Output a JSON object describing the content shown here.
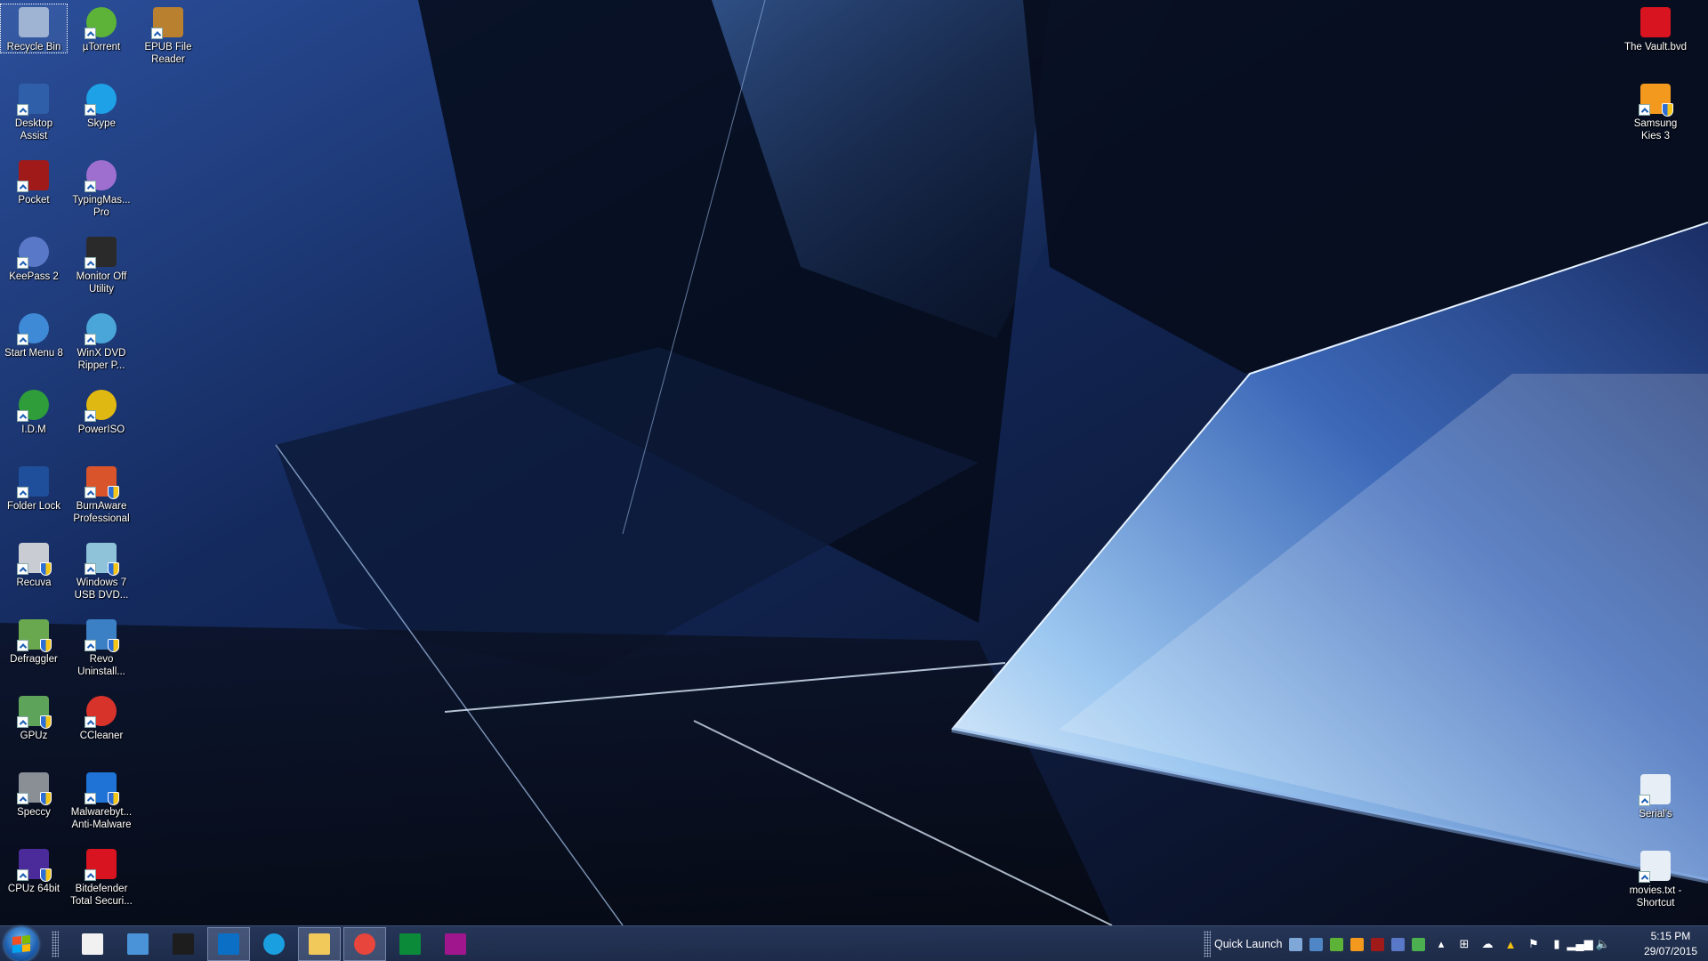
{
  "desktop": {
    "left_icons": [
      {
        "label": "Recycle Bin",
        "icon": "recycle-bin-icon",
        "col": 0,
        "row": 0,
        "selected": true,
        "shortcut": false,
        "shield": false,
        "color": "#9fb4d2"
      },
      {
        "label": "µTorrent",
        "icon": "utorrent-icon",
        "col": 1,
        "row": 0,
        "shortcut": true,
        "shield": false,
        "color": "#5cb338"
      },
      {
        "label": "EPUB File Reader",
        "icon": "epub-reader-icon",
        "col": 2,
        "row": 0,
        "shortcut": true,
        "shield": false,
        "color": "#b9802f"
      },
      {
        "label": "Desktop Assist",
        "icon": "desktop-assist-icon",
        "col": 0,
        "row": 1,
        "shortcut": true,
        "shield": false,
        "color": "#2f5fa8"
      },
      {
        "label": "Skype",
        "icon": "skype-icon",
        "col": 1,
        "row": 1,
        "shortcut": true,
        "shield": false,
        "color": "#1ea1e6"
      },
      {
        "label": "Pocket",
        "icon": "pocket-icon",
        "col": 0,
        "row": 2,
        "shortcut": true,
        "shield": false,
        "color": "#a11a1a"
      },
      {
        "label": "TypingMas... Pro",
        "icon": "typingmaster-icon",
        "col": 1,
        "row": 2,
        "shortcut": true,
        "shield": false,
        "color": "#9f6fd0"
      },
      {
        "label": "KeePass 2",
        "icon": "keepass-icon",
        "col": 0,
        "row": 3,
        "shortcut": true,
        "shield": false,
        "color": "#5a78c8"
      },
      {
        "label": "Monitor Off Utility",
        "icon": "monitor-off-icon",
        "col": 1,
        "row": 3,
        "shortcut": true,
        "shield": false,
        "color": "#2a2a2a"
      },
      {
        "label": "Start Menu 8",
        "icon": "start-menu-8-icon",
        "col": 0,
        "row": 4,
        "shortcut": true,
        "shield": false,
        "color": "#3f8ad6"
      },
      {
        "label": "WinX DVD Ripper P...",
        "icon": "winx-dvd-icon",
        "col": 1,
        "row": 4,
        "shortcut": true,
        "shield": false,
        "color": "#4aa6d8"
      },
      {
        "label": "I.D.M",
        "icon": "idm-icon",
        "col": 0,
        "row": 5,
        "shortcut": true,
        "shield": false,
        "color": "#2e9d3a"
      },
      {
        "label": "PowerISO",
        "icon": "poweriso-icon",
        "col": 1,
        "row": 5,
        "shortcut": true,
        "shield": false,
        "color": "#e0b812"
      },
      {
        "label": "Folder Lock",
        "icon": "folder-lock-icon",
        "col": 0,
        "row": 6,
        "shortcut": true,
        "shield": false,
        "color": "#1f4f9a"
      },
      {
        "label": "BurnAware Professional",
        "icon": "burnaware-icon",
        "col": 1,
        "row": 6,
        "shortcut": true,
        "shield": true,
        "color": "#d9542b"
      },
      {
        "label": "Recuva",
        "icon": "recuva-icon",
        "col": 0,
        "row": 7,
        "shortcut": true,
        "shield": true,
        "color": "#c9cdd3"
      },
      {
        "label": "Windows 7 USB DVD...",
        "icon": "win7-usb-dvd-icon",
        "col": 1,
        "row": 7,
        "shortcut": true,
        "shield": true,
        "color": "#8fc3d9"
      },
      {
        "label": "Defraggler",
        "icon": "defraggler-icon",
        "col": 0,
        "row": 8,
        "shortcut": true,
        "shield": true,
        "color": "#6aa84f"
      },
      {
        "label": "Revo Uninstall...",
        "icon": "revo-uninstaller-icon",
        "col": 1,
        "row": 8,
        "shortcut": true,
        "shield": true,
        "color": "#3b7fc4"
      },
      {
        "label": "GPUz",
        "icon": "gpuz-icon",
        "col": 0,
        "row": 9,
        "shortcut": true,
        "shield": true,
        "color": "#5ea35a"
      },
      {
        "label": "CCleaner",
        "icon": "ccleaner-icon",
        "col": 1,
        "row": 9,
        "shortcut": true,
        "shield": false,
        "color": "#d8332b"
      },
      {
        "label": "Speccy",
        "icon": "speccy-icon",
        "col": 0,
        "row": 10,
        "shortcut": true,
        "shield": true,
        "color": "#8a8f96"
      },
      {
        "label": "Malwarebyt... Anti-Malware",
        "icon": "malwarebytes-icon",
        "col": 1,
        "row": 10,
        "shortcut": true,
        "shield": true,
        "color": "#1f73d6"
      },
      {
        "label": "CPUz 64bit",
        "icon": "cpuz-icon",
        "col": 0,
        "row": 11,
        "shortcut": true,
        "shield": true,
        "color": "#4b2a9a"
      },
      {
        "label": "Bitdefender Total Securi...",
        "icon": "bitdefender-icon",
        "col": 1,
        "row": 11,
        "shortcut": true,
        "shield": false,
        "color": "#d7141f"
      }
    ],
    "right_icons": [
      {
        "label": "The Vault.bvd",
        "icon": "bitdefender-vault-icon",
        "slot": "top0",
        "shortcut": false,
        "shield": false,
        "color": "#d7141f"
      },
      {
        "label": "Samsung Kies 3",
        "icon": "samsung-kies-icon",
        "slot": "top1",
        "shortcut": true,
        "shield": true,
        "color": "#f39a1e"
      },
      {
        "label": "Serial's",
        "icon": "text-file-icon",
        "slot": "bottom1",
        "shortcut": true,
        "shield": false,
        "color": "#e8eef6"
      },
      {
        "label": "movies.txt - Shortcut",
        "icon": "text-file-icon",
        "slot": "bottom0",
        "shortcut": true,
        "shield": false,
        "color": "#e8eef6"
      }
    ]
  },
  "taskbar": {
    "start_button": "start-button",
    "pinned": [
      {
        "name": "apps-launcher",
        "icon": "apps-grid-icon",
        "active": false
      },
      {
        "name": "control-panel",
        "icon": "control-panel-icon",
        "active": false
      },
      {
        "name": "plex-app",
        "icon": "plex-chevron-icon",
        "active": false
      },
      {
        "name": "mail",
        "icon": "mail-icon",
        "active": true
      },
      {
        "name": "internet-explorer",
        "icon": "internet-explorer-icon",
        "active": false
      },
      {
        "name": "file-explorer",
        "icon": "file-explorer-icon",
        "active": true
      },
      {
        "name": "chrome",
        "icon": "chrome-icon",
        "active": true
      },
      {
        "name": "windows-store",
        "icon": "store-icon",
        "active": false
      },
      {
        "name": "camera",
        "icon": "camera-icon",
        "active": false
      }
    ],
    "quick_launch": {
      "label": "Quick Launch",
      "items": [
        {
          "icon": "show-desktop-icon",
          "color": "#7fa8d8"
        },
        {
          "icon": "switch-windows-icon",
          "color": "#4f86c6"
        },
        {
          "icon": "utorrent-icon",
          "color": "#5cb338"
        },
        {
          "icon": "samsung-kies-icon",
          "color": "#f39a1e"
        },
        {
          "icon": "pocket-icon",
          "color": "#a11a1a"
        },
        {
          "icon": "keepass-icon",
          "color": "#5a78c8"
        },
        {
          "icon": "pushbullet-icon",
          "color": "#4caf50"
        }
      ]
    },
    "tray": [
      {
        "icon": "show-hidden-icons-icon",
        "glyph": "▴"
      },
      {
        "icon": "windows-icon",
        "glyph": "⊞"
      },
      {
        "icon": "onedrive-icon",
        "glyph": "☁"
      },
      {
        "icon": "google-drive-icon",
        "glyph": "▲"
      },
      {
        "icon": "action-center-flag-icon",
        "glyph": "⚑"
      },
      {
        "icon": "power-icon",
        "glyph": "▮"
      },
      {
        "icon": "network-signal-icon",
        "glyph": "▂▄▆"
      },
      {
        "icon": "volume-icon",
        "glyph": "🔈"
      }
    ],
    "clock": {
      "time": "5:15 PM",
      "date": "29/07/2015"
    }
  }
}
